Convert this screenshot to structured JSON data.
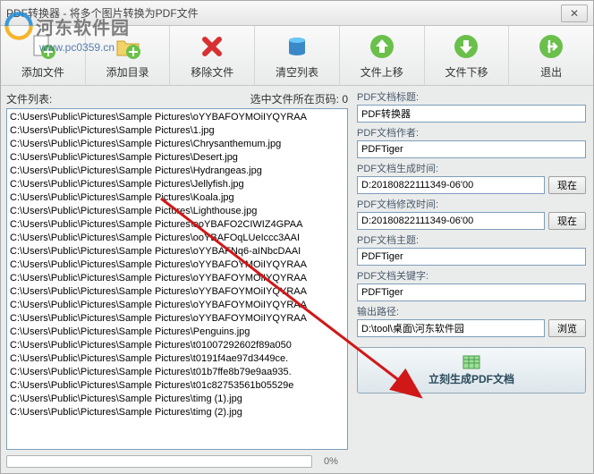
{
  "window": {
    "title": "PDF转换器 - 将多个图片转换为PDF文件"
  },
  "toolbar": [
    {
      "label": "添加文件",
      "name": "add-file-button",
      "icon": "add-file"
    },
    {
      "label": "添加目录",
      "name": "add-folder-button",
      "icon": "add-folder"
    },
    {
      "label": "移除文件",
      "name": "remove-file-button",
      "icon": "remove"
    },
    {
      "label": "清空列表",
      "name": "clear-list-button",
      "icon": "clear"
    },
    {
      "label": "文件上移",
      "name": "move-up-button",
      "icon": "up"
    },
    {
      "label": "文件下移",
      "name": "move-down-button",
      "icon": "down"
    },
    {
      "label": "退出",
      "name": "exit-button",
      "icon": "exit"
    }
  ],
  "left": {
    "list_label": "文件列表:",
    "page_label": "选中文件所在页码: 0",
    "files": [
      "C:\\Users\\Public\\Pictures\\Sample Pictures\\oYYBAFOYMOiIYQYRAA",
      "C:\\Users\\Public\\Pictures\\Sample Pictures\\1.jpg",
      "C:\\Users\\Public\\Pictures\\Sample Pictures\\Chrysanthemum.jpg",
      "C:\\Users\\Public\\Pictures\\Sample Pictures\\Desert.jpg",
      "C:\\Users\\Public\\Pictures\\Sample Pictures\\Hydrangeas.jpg",
      "C:\\Users\\Public\\Pictures\\Sample Pictures\\Jellyfish.jpg",
      "C:\\Users\\Public\\Pictures\\Sample Pictures\\Koala.jpg",
      "C:\\Users\\Public\\Pictures\\Sample Pictures\\Lighthouse.jpg",
      "C:\\Users\\Public\\Pictures\\Sample Pictures\\ooYBAFO2CIWIZ4GPAA",
      "C:\\Users\\Public\\Pictures\\Sample Pictures\\ooYBAFOqLUeIccc3AAI",
      "C:\\Users\\Public\\Pictures\\Sample Pictures\\oYYBAFNq6-aINbcDAAI",
      "C:\\Users\\Public\\Pictures\\Sample Pictures\\oYYBAFOYMOiIYQYRAA",
      "C:\\Users\\Public\\Pictures\\Sample Pictures\\oYYBAFOYMOiIYQYRAA",
      "C:\\Users\\Public\\Pictures\\Sample Pictures\\oYYBAFOYMOiIYQYRAA",
      "C:\\Users\\Public\\Pictures\\Sample Pictures\\oYYBAFOYMOiIYQYRAA",
      "C:\\Users\\Public\\Pictures\\Sample Pictures\\oYYBAFOYMOiIYQYRAA",
      "C:\\Users\\Public\\Pictures\\Sample Pictures\\Penguins.jpg",
      "C:\\Users\\Public\\Pictures\\Sample Pictures\\t01007292602f89a050",
      "C:\\Users\\Public\\Pictures\\Sample Pictures\\t0191f4ae97d3449ce.",
      "C:\\Users\\Public\\Pictures\\Sample Pictures\\t01b7ffe8b79e9aa935.",
      "C:\\Users\\Public\\Pictures\\Sample Pictures\\t01c82753561b05529e",
      "C:\\Users\\Public\\Pictures\\Sample Pictures\\timg (1).jpg",
      "C:\\Users\\Public\\Pictures\\Sample Pictures\\timg (2).jpg"
    ],
    "progress": "0%"
  },
  "right": {
    "title_label": "PDF文档标题:",
    "title_value": "PDF转换器",
    "author_label": "PDF文档作者:",
    "author_value": "PDFTiger",
    "created_label": "PDF文档生成时间:",
    "created_value": "D:20180822111349-06'00",
    "modified_label": "PDF文档修改时间:",
    "modified_value": "D:20180822111349-06'00",
    "subject_label": "PDF文档主题:",
    "subject_value": "PDFTiger",
    "keywords_label": "PDF文档关键字:",
    "keywords_value": "PDFTiger",
    "output_label": "输出路径:",
    "output_value": "D:\\tool\\桌面\\河东软件园",
    "now_btn": "现在",
    "browse_btn": "浏览",
    "generate_btn": "立刻生成PDF文档"
  },
  "watermark": {
    "text": "河东软件园",
    "url": "www.pc0359.cn"
  }
}
